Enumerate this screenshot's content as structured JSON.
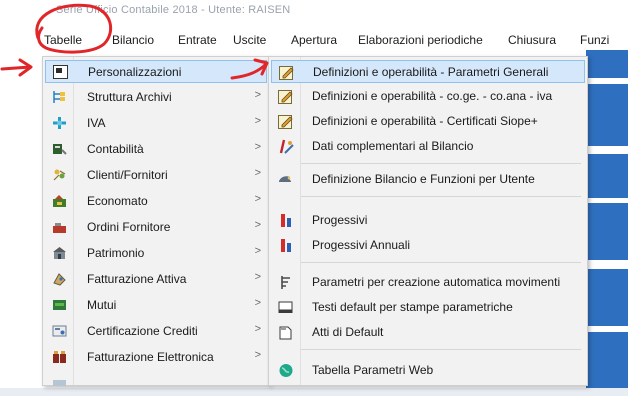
{
  "window": {
    "title": "Serie Ufficio Contabile 2018 - Utente: RAISEN"
  },
  "menubar": [
    {
      "id": "tabelle",
      "label": "Tabelle"
    },
    {
      "id": "bilancio",
      "label": "Bilancio"
    },
    {
      "id": "entrate",
      "label": "Entrate"
    },
    {
      "id": "uscite",
      "label": "Uscite"
    },
    {
      "id": "apertura",
      "label": "Apertura"
    },
    {
      "id": "elaborazioni",
      "label": "Elaborazioni periodiche"
    },
    {
      "id": "chiusura",
      "label": "Chiusura"
    },
    {
      "id": "funzioni",
      "label": "Funzi"
    }
  ],
  "tabelle_menu": [
    {
      "label": "Personalizzazioni",
      "icon": "customize-icon",
      "selected": true,
      "submenu": true
    },
    {
      "label": "Struttura Archivi",
      "icon": "archive-structure-icon",
      "submenu": true
    },
    {
      "label": "IVA",
      "icon": "iva-icon",
      "submenu": true
    },
    {
      "label": "Contabilità",
      "icon": "accounting-icon",
      "submenu": true
    },
    {
      "label": "Clienti/Fornitori",
      "icon": "customers-suppliers-icon",
      "submenu": true
    },
    {
      "label": "Economato",
      "icon": "economato-icon",
      "submenu": true
    },
    {
      "label": "Ordini Fornitore",
      "icon": "supplier-orders-icon",
      "submenu": true
    },
    {
      "label": "Patrimonio",
      "icon": "assets-icon",
      "submenu": true
    },
    {
      "label": "Fatturazione Attiva",
      "icon": "invoicing-icon",
      "submenu": true
    },
    {
      "label": "Mutui",
      "icon": "loans-icon",
      "submenu": true
    },
    {
      "label": "Certificazione Crediti",
      "icon": "credit-certification-icon",
      "submenu": true
    },
    {
      "label": "Fatturazione Elettronica",
      "icon": "e-invoicing-icon",
      "submenu": true
    }
  ],
  "personalizzazioni_menu": [
    {
      "label": "Definizioni e operabilità - Parametri Generali",
      "icon": "edit-parameters-icon",
      "selected": true
    },
    {
      "label": "Definizioni e operabilità - co.ge. - co.ana - iva",
      "icon": "edit-parameters-icon"
    },
    {
      "label": "Definizioni e operabilità - Certificati Siope+",
      "icon": "edit-parameters-icon"
    },
    {
      "label": "Dati complementari al Bilancio",
      "icon": "budget-data-icon"
    },
    {
      "label": "Definizione Bilancio e Funzioni per Utente",
      "icon": "user-functions-icon"
    },
    {
      "label": "Progessivi",
      "icon": "progressive-icon"
    },
    {
      "label": "Progessivi Annuali",
      "icon": "progressive-icon"
    },
    {
      "label": "Parametri per creazione automatica movimenti",
      "icon": "automatic-movements-icon"
    },
    {
      "label": "Testi default per stampe parametriche",
      "icon": "print-texts-icon"
    },
    {
      "label": "Atti di Default",
      "icon": "default-acts-icon"
    },
    {
      "label": "Tabella Parametri Web",
      "icon": "web-parameters-icon"
    }
  ],
  "colors": {
    "selection_bg": "#d5e8fb",
    "selection_border": "#8ec0f0",
    "annotation_red": "#e1262a",
    "menu_bg": "#f2f2f2"
  }
}
